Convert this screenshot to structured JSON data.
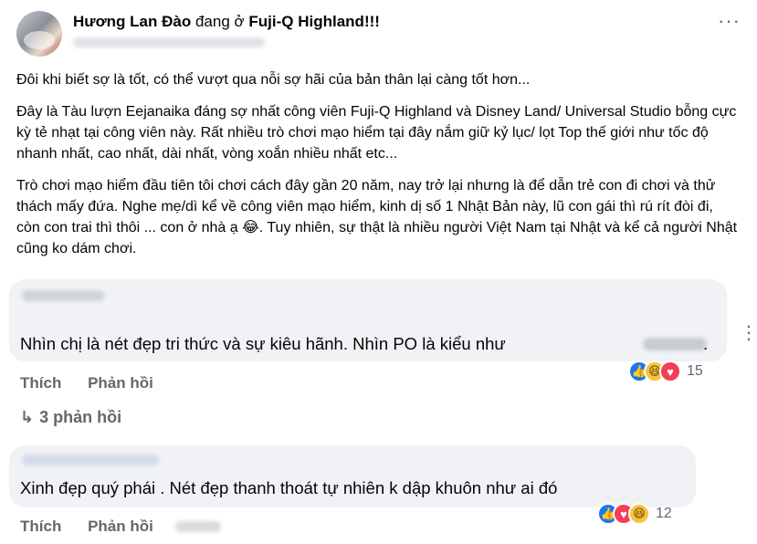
{
  "post": {
    "author": "Hương Lan Đào",
    "at_text": "đang ở",
    "place": "Fuji-Q Highland!!!",
    "more": "···",
    "paragraphs": [
      "Đôi khi biết sợ là tốt, có thể vượt qua nỗi sợ hãi của bản thân lại càng tốt hơn...",
      "Đây là Tàu lượn Eejanaika đáng sợ nhất công viên Fuji-Q Highland và Disney Land/ Universal Studio bỗng cực kỳ tẻ nhạt tại công viên này. Rất nhiều trò chơi mạo hiểm tại đây nắm giữ kỷ lục/ lọt Top thế giới như tốc độ nhanh nhất, cao nhất, dài nhất, vòng xoắn nhiều nhất etc...",
      "Trò chơi mạo hiểm đầu tiên tôi chơi cách đây gần 20 năm, nay trở lại nhưng là để dẫn trẻ con đi chơi và thử thách mấy đứa. Nghe mẹ/dì kể về công viên mạo hiểm, kinh dị số 1 Nhật Bản này, lũ con gái thì rú rít đòi đi, còn con trai thì thôi ... con ở nhà ạ 😂. Tuy nhiên, sự thật là nhiều người Việt Nam tại Nhật và kể cả người Nhật cũng ko dám chơi."
    ]
  },
  "comments": [
    {
      "text": "Nhìn chị là nét đẹp tri thức và sự kiêu hãnh. Nhìn PO là kiểu như",
      "tail": ".",
      "like_label": "Thích",
      "reply_label": "Phản hồi",
      "reactions": [
        "like",
        "haha",
        "love"
      ],
      "reaction_count": "15"
    },
    {
      "text": "Xinh đẹp quý phái . Nét đẹp thanh thoát tự nhiên k dập khuôn như ai đó",
      "like_label": "Thích",
      "reply_label": "Phản hồi",
      "reactions": [
        "like",
        "love",
        "haha"
      ],
      "reaction_count": "12"
    }
  ],
  "replies": {
    "arrow": "↳",
    "label": "3 phản hồi"
  },
  "side_more": "⋮",
  "icons": {
    "like": "👍",
    "love": "♥",
    "haha": "😆"
  },
  "colors": {
    "bubble": "#f0f2f5",
    "secondary_text": "#65676b",
    "like_blue": "#1877f2",
    "love_red": "#f33e58",
    "haha_yellow": "#f7c53b"
  }
}
